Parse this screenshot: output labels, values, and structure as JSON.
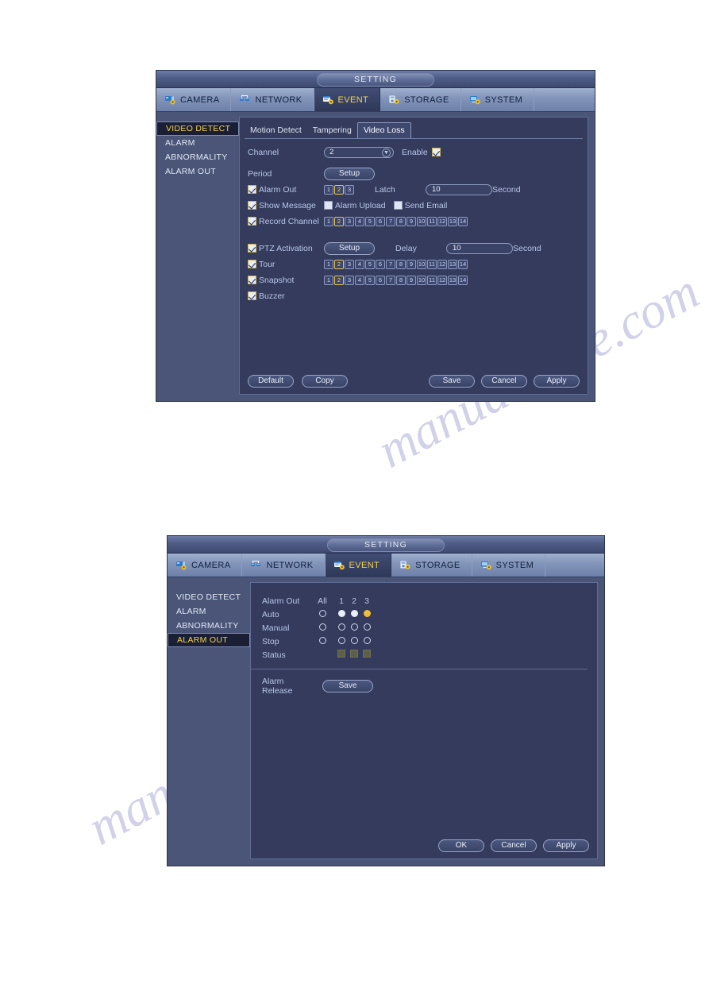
{
  "colors": {
    "dialog_bg": "#4a5578",
    "panel_bg": "#343b5c",
    "accent_yellow": "#f5d44c",
    "label_blue": "#b9c6ea",
    "border_blue": "#8e9bbe",
    "status_square": "#5d5f46",
    "radio_on_white": "#e9eefb",
    "radio_on_yellow": "#f0bd3a"
  },
  "watermark": {
    "line1": "manualshive.com",
    "line2": "manualshive.com"
  },
  "dialog1": {
    "title": "SETTING",
    "menu_tabs": [
      {
        "label": "CAMERA",
        "icon": "camera-gear-icon",
        "active": false
      },
      {
        "label": "NETWORK",
        "icon": "network-icon",
        "active": false
      },
      {
        "label": "EVENT",
        "icon": "event-gear-icon",
        "active": true
      },
      {
        "label": "STORAGE",
        "icon": "storage-gear-icon",
        "active": false
      },
      {
        "label": "SYSTEM",
        "icon": "system-gear-icon",
        "active": false
      }
    ],
    "sidebar": [
      {
        "label": "VIDEO DETECT",
        "selected": true
      },
      {
        "label": "ALARM",
        "selected": false
      },
      {
        "label": "ABNORMALITY",
        "selected": false
      },
      {
        "label": "ALARM OUT",
        "selected": false
      }
    ],
    "inner_tabs": [
      {
        "label": "Motion Detect",
        "active": false
      },
      {
        "label": "Tampering",
        "active": false
      },
      {
        "label": "Video Loss",
        "active": true
      }
    ],
    "form": {
      "channel_label": "Channel",
      "channel_value": "2",
      "enable_label": "Enable",
      "enable_checked": true,
      "period_label": "Period",
      "period_button": "Setup",
      "alarm_out_label": "Alarm Out",
      "alarm_out_checked": true,
      "alarm_out_chips": [
        "1",
        "2",
        "3"
      ],
      "alarm_out_selected": [
        "2"
      ],
      "latch_label": "Latch",
      "latch_value": "10",
      "latch_unit": "Second",
      "show_message_label": "Show Message",
      "show_message_checked": true,
      "alarm_upload_label": "Alarm Upload",
      "alarm_upload_checked": false,
      "send_email_label": "Send Email",
      "send_email_checked": false,
      "record_channel_label": "Record Channel",
      "record_channel_checked": true,
      "record_channel_chips": [
        "1",
        "2",
        "3",
        "4",
        "5",
        "6",
        "7",
        "8",
        "9",
        "10",
        "11",
        "12",
        "13",
        "14"
      ],
      "record_channel_selected": [
        "2"
      ],
      "ptz_label": "PTZ Activation",
      "ptz_checked": true,
      "ptz_button": "Setup",
      "delay_label": "Delay",
      "delay_value": "10",
      "delay_unit": "Second",
      "tour_label": "Tour",
      "tour_checked": true,
      "tour_chips": [
        "1",
        "2",
        "3",
        "4",
        "5",
        "6",
        "7",
        "8",
        "9",
        "10",
        "11",
        "12",
        "13",
        "14"
      ],
      "tour_selected": [
        "2"
      ],
      "snapshot_label": "Snapshot",
      "snapshot_checked": true,
      "snapshot_chips": [
        "1",
        "2",
        "3",
        "4",
        "5",
        "6",
        "7",
        "8",
        "9",
        "10",
        "11",
        "12",
        "13",
        "14"
      ],
      "snapshot_selected": [
        "2"
      ],
      "buzzer_label": "Buzzer",
      "buzzer_checked": true
    },
    "buttons": {
      "default": "Default",
      "copy": "Copy",
      "save": "Save",
      "cancel": "Cancel",
      "apply": "Apply"
    }
  },
  "dialog2": {
    "title": "SETTING",
    "menu_tabs": [
      {
        "label": "CAMERA",
        "icon": "camera-gear-icon",
        "active": false
      },
      {
        "label": "NETWORK",
        "icon": "network-icon",
        "active": false
      },
      {
        "label": "EVENT",
        "icon": "event-gear-icon",
        "active": true
      },
      {
        "label": "STORAGE",
        "icon": "storage-gear-icon",
        "active": false
      },
      {
        "label": "SYSTEM",
        "icon": "system-gear-icon",
        "active": false
      }
    ],
    "sidebar": [
      {
        "label": "VIDEO DETECT",
        "selected": false
      },
      {
        "label": "ALARM",
        "selected": false
      },
      {
        "label": "ABNORMALITY",
        "selected": false
      },
      {
        "label": "ALARM OUT",
        "selected": true
      }
    ],
    "alarm_out_table": {
      "header_label": "Alarm Out",
      "all_label": "All",
      "channels": [
        "1",
        "2",
        "3"
      ],
      "rows": [
        {
          "label": "Auto",
          "all": "off",
          "states": [
            "white",
            "white",
            "yellow"
          ]
        },
        {
          "label": "Manual",
          "all": "off",
          "states": [
            "off",
            "off",
            "off"
          ]
        },
        {
          "label": "Stop",
          "all": "off",
          "states": [
            "off",
            "off",
            "off"
          ]
        }
      ],
      "status_label": "Status",
      "status_states": [
        "dim",
        "dim",
        "dim"
      ]
    },
    "alarm_release_label": "Alarm Release",
    "alarm_release_button": "Save",
    "buttons": {
      "ok": "OK",
      "cancel": "Cancel",
      "apply": "Apply"
    }
  }
}
